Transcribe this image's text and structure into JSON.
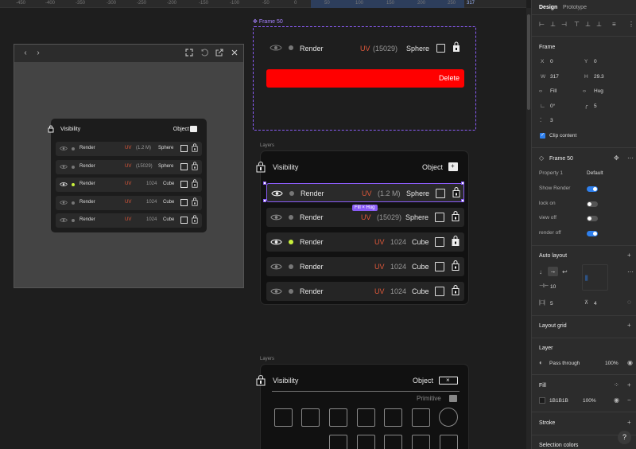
{
  "ruler": {
    "ticks": [
      "-450",
      "-400",
      "-350",
      "-300",
      "-250",
      "-200",
      "-150",
      "-100",
      "-50",
      "0",
      "50",
      "100",
      "150",
      "200",
      "250",
      "317"
    ]
  },
  "preview": {
    "nav": [
      "‹",
      "›"
    ],
    "icons": [
      "fullscreen-icon",
      "reset-icon",
      "external-icon",
      "close-icon"
    ],
    "panel": {
      "title": "Visibility",
      "object_label": "Object",
      "rows": [
        {
          "label": "Render",
          "uv": "UV",
          "count": "(1.2 M)",
          "shape": "Sphere",
          "active": false
        },
        {
          "label": "Render",
          "uv": "UV",
          "count": "(15029)",
          "shape": "Sphere",
          "active": false
        },
        {
          "label": "Render",
          "uv": "UV",
          "count": "1024",
          "shape": "Cube",
          "active": true
        },
        {
          "label": "Render",
          "uv": "UV",
          "count": "1024",
          "shape": "Cube",
          "active": false
        },
        {
          "label": "Render",
          "uv": "UV",
          "count": "1024",
          "shape": "Cube",
          "active": false
        }
      ]
    }
  },
  "frame50": {
    "label": "Frame 50",
    "row": {
      "label": "Render",
      "uv": "UV",
      "count": "(15029)",
      "shape": "Sphere"
    },
    "delete_label": "Delete"
  },
  "mid": {
    "layers_label": "Layers",
    "title": "Visibility",
    "object_label": "Object",
    "fill_hug": "Fill × Hug",
    "rows": [
      {
        "label": "Render",
        "uv": "UV",
        "count": "(1.2 M)",
        "shape": "Sphere",
        "active": false,
        "selected": true
      },
      {
        "label": "Render",
        "uv": "UV",
        "count": "(15029)",
        "shape": "Sphere",
        "active": false,
        "selected": false
      },
      {
        "label": "Render",
        "uv": "UV",
        "count": "1024",
        "shape": "Cube",
        "active": true,
        "selected": false
      },
      {
        "label": "Render",
        "uv": "UV",
        "count": "1024",
        "shape": "Cube",
        "active": false,
        "selected": false
      },
      {
        "label": "Render",
        "uv": "UV",
        "count": "1024",
        "shape": "Cube",
        "active": false,
        "selected": false
      }
    ]
  },
  "bottom": {
    "layers_label": "Layers",
    "title": "Visibility",
    "object_label": "Object",
    "primitive_label": "Primitive"
  },
  "design_panel": {
    "tabs": [
      "Design",
      "Prototype"
    ],
    "frame_section": "Frame",
    "x_label": "X",
    "x_value": "0",
    "y_label": "Y",
    "y_value": "0",
    "w_label": "W",
    "w_value": "317",
    "h_label": "H",
    "h_value": "29.3",
    "fill_mode": "Fill",
    "hug_mode": "Hug",
    "rotation": "0°",
    "radius": "5",
    "clip_count": "3",
    "clip_content": "Clip content",
    "component_name": "Frame 50",
    "property_label": "Property 1",
    "property_value": "Default",
    "toggles": [
      {
        "label": "Show Render",
        "on": true
      },
      {
        "label": "lock on",
        "on": false
      },
      {
        "label": "view off",
        "on": false
      },
      {
        "label": "render off",
        "on": true
      }
    ],
    "auto_layout": "Auto layout",
    "gap": "10",
    "pad_h": "5",
    "pad_v": "4",
    "layout_grid": "Layout grid",
    "layer": "Layer",
    "blend": "Pass through",
    "layer_opacity": "100%",
    "fill": "Fill",
    "fill_hex": "1B1B1B",
    "fill_opacity": "100%",
    "stroke": "Stroke",
    "selection_colors": "Selection colors",
    "help": "?"
  },
  "colors": {
    "accent": "#8a5cf6",
    "delete": "#ff0000",
    "uv": "#e0583a",
    "active_dot": "#c8f03c",
    "toggle_on": "#2f80ed"
  }
}
